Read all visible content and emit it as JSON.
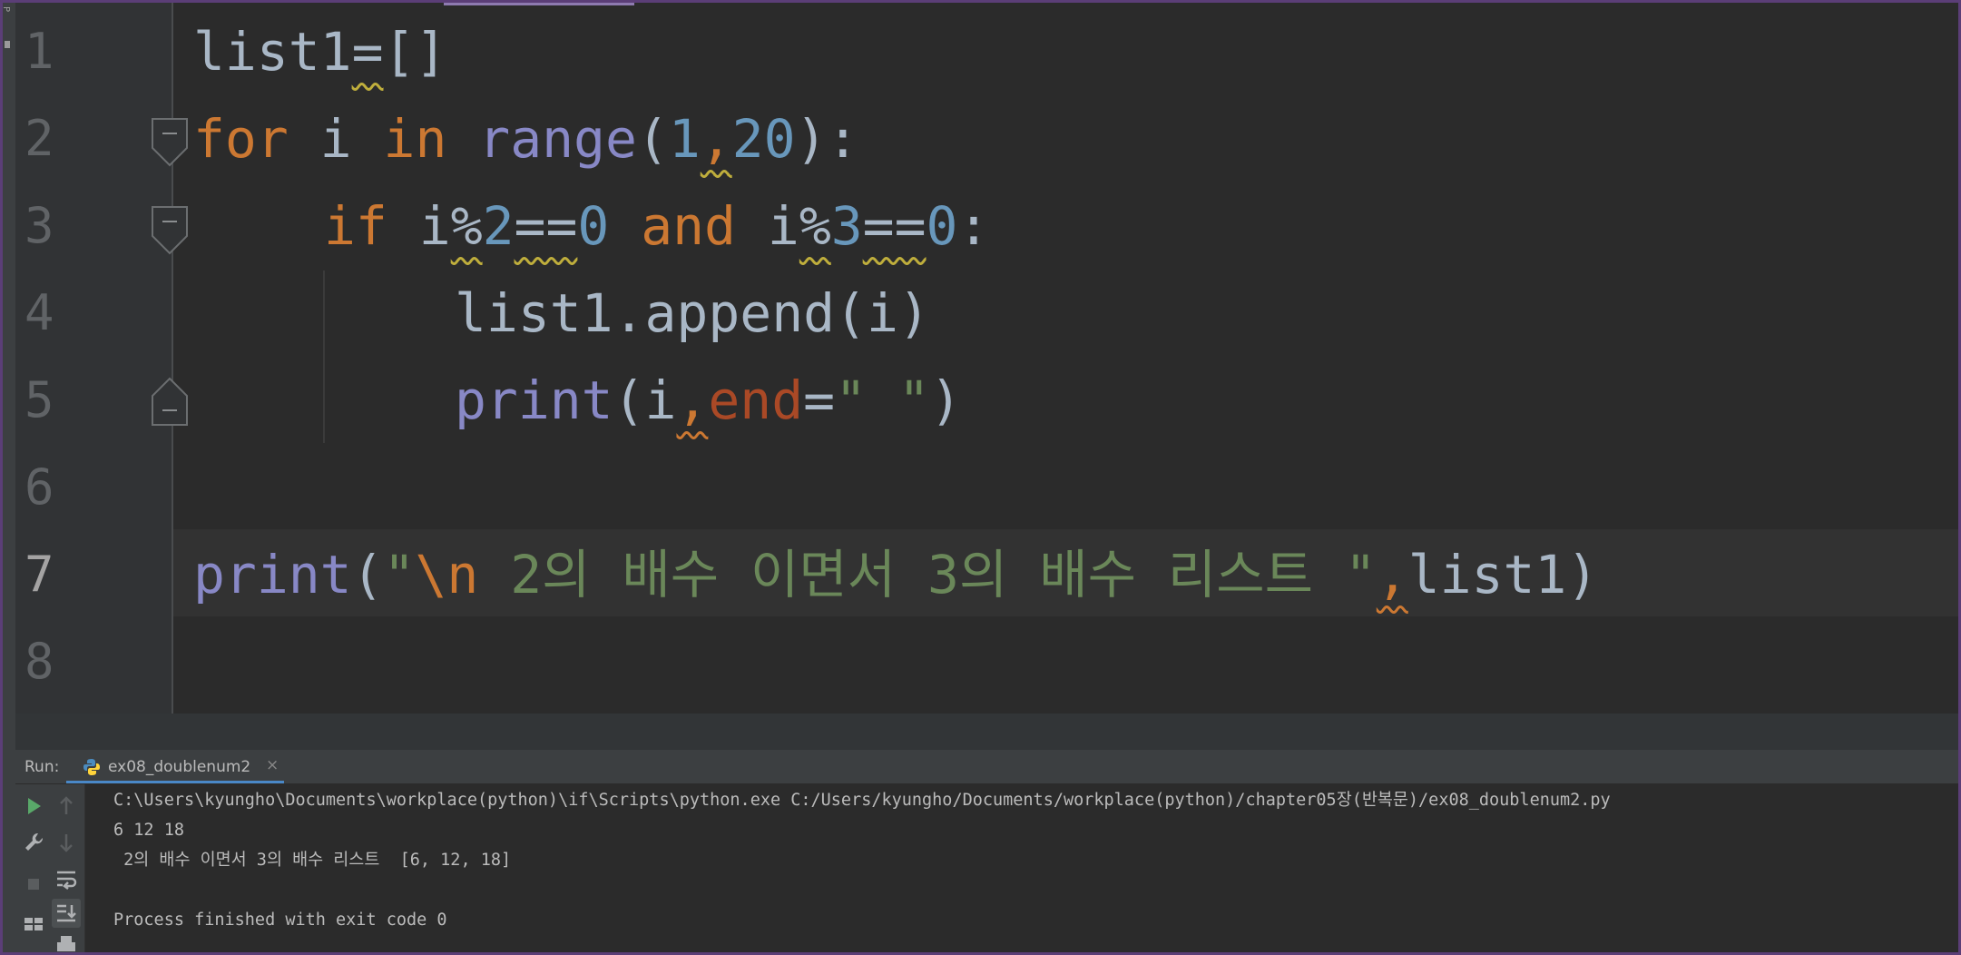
{
  "editor": {
    "line_numbers": [
      "1",
      "2",
      "3",
      "4",
      "5",
      "6",
      "7",
      "8"
    ],
    "current_line": "7",
    "code": {
      "l1": {
        "a": "list1",
        "b": "=",
        "c": "[]"
      },
      "l2": {
        "for": "for",
        "i": " i ",
        "in": "in",
        "sp": " ",
        "range": "range",
        "open": "(",
        "n1": "1",
        "comma": ",",
        "n2": "20",
        "close": "):"
      },
      "l3": {
        "if": "if",
        "sp": " ",
        "i1": "i",
        "mod1": "%",
        "n2": "2",
        "eq1": "==",
        "z1": "0",
        "sp2": " ",
        "and": "and",
        "sp3": " ",
        "i2": "i",
        "mod2": "%",
        "n3": "3",
        "eq2": "==",
        "z2": "0",
        "colon": ":"
      },
      "l4": {
        "text": "list1.append(i)"
      },
      "l5": {
        "print": "print",
        "open": "(i",
        "comma": ",",
        "end": "end",
        "eq": "=",
        "str": "\" \"",
        "close": ")"
      },
      "l7": {
        "print": "print",
        "open": "(",
        "q": "\"",
        "esc": "\\n",
        "str": " 2의 배수 이면서 3의 배수 리스트 \"",
        "comma": ",",
        "rest": "list1)"
      }
    }
  },
  "run_panel": {
    "label": "Run:",
    "tab_label": "ex08_doublenum2",
    "close_glyph": "×",
    "console_lines": [
      "C:\\Users\\kyungho\\Documents\\workplace(python)\\if\\Scripts\\python.exe C:/Users/kyungho/Documents/workplace(python)/chapter05장(반복문)/ex08_doublenum2.py",
      "6 12 18",
      " 2의 배수 이면서 3의 배수 리스트  [6, 12, 18]",
      "",
      "Process finished with exit code 0"
    ]
  },
  "icons": [
    "run-icon",
    "wrench-icon",
    "stop-icon",
    "layout-icon",
    "up-arrow-icon",
    "down-arrow-icon",
    "soft-wrap-icon",
    "scroll-to-end-icon",
    "print-icon",
    "python-icon",
    "fold-icon"
  ],
  "colors": {
    "keyword": "#cc7832",
    "builtin": "#8888c6",
    "number": "#6897bb",
    "string": "#6a8759",
    "param": "#aa4926",
    "text": "#a9b7c6",
    "accent": "#4a88c7"
  }
}
